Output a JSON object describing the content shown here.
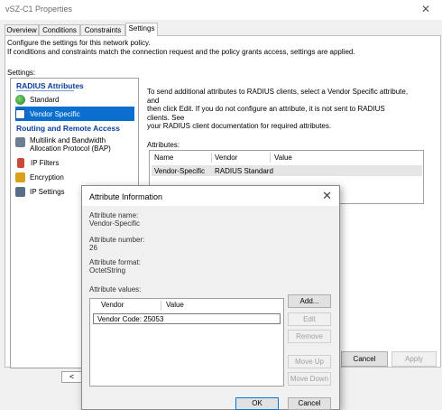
{
  "window": {
    "title": "vSZ-C1 Properties"
  },
  "tabs": [
    {
      "label": "Overview"
    },
    {
      "label": "Conditions"
    },
    {
      "label": "Constraints"
    },
    {
      "label": "Settings"
    }
  ],
  "description": {
    "line1": "Configure the settings for this network policy.",
    "line2": "If conditions and constraints match the connection request and the policy grants access, settings are applied."
  },
  "settings_label": "Settings:",
  "tree": {
    "radius_header": "RADIUS Attributes",
    "radius_items": [
      {
        "label": "Standard",
        "icon": "globe-icon"
      },
      {
        "label": "Vendor Specific",
        "icon": "vendor-specific-icon"
      }
    ],
    "routing_header": "Routing and Remote Access",
    "routing_items": [
      {
        "label_line1": "Multilink and Bandwidth",
        "label_line2": "Allocation Protocol (BAP)",
        "icon": "multilink-icon"
      },
      {
        "label": "IP Filters",
        "icon": "ip-filter-icon"
      },
      {
        "label": "Encryption",
        "icon": "lock-icon"
      },
      {
        "label": "IP Settings",
        "icon": "network-icon"
      }
    ]
  },
  "right_panel": {
    "line1": "To send additional attributes to RADIUS clients, select a Vendor Specific attribute, and",
    "line2": "then click Edit. If you do not configure an attribute, it is not sent to RADIUS clients. See",
    "line3": "your RADIUS client documentation for required attributes.",
    "attributes_label": "Attributes:",
    "columns": [
      "Name",
      "Vendor",
      "Value"
    ],
    "rows": [
      {
        "name": "Vendor-Specific",
        "vendor": "RADIUS Standard",
        "value": ""
      }
    ]
  },
  "footer": {
    "scroll_left_glyph": "<",
    "cancel": "Cancel",
    "apply": "Apply"
  },
  "dialog": {
    "title": "Attribute Information",
    "close_glyph": "✕",
    "name_label": "Attribute name:",
    "name_value": "Vendor-Specific",
    "number_label": "Attribute number:",
    "number_value": "26",
    "format_label": "Attribute format:",
    "format_value": "OctetString",
    "values_label": "Attribute values:",
    "columns": [
      "Vendor",
      "Value"
    ],
    "rows": [
      {
        "vendor": "Vendor Code: 25053",
        "value": ""
      }
    ],
    "buttons": {
      "add": "Add...",
      "edit": "Edit",
      "remove": "Remove",
      "move_up": "Move Up",
      "move_down": "Move Down",
      "ok": "OK",
      "cancel": "Cancel"
    }
  }
}
